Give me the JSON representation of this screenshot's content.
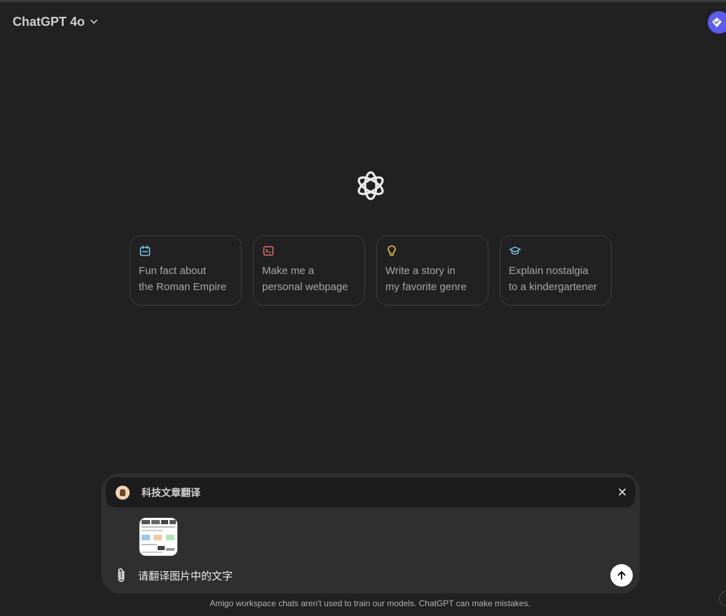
{
  "header": {
    "model_label": "ChatGPT 4o",
    "model_chevron_icon": "chevron-down-icon",
    "extension_icon": "diamond-check-icon",
    "extension_color": "#5b5cf0"
  },
  "hero": {
    "logo_icon": "openai-logo-icon"
  },
  "suggestions": [
    {
      "icon": "calendar-icon",
      "color": "#7cc4e8",
      "line1": "Fun fact about",
      "line2": "the Roman Empire"
    },
    {
      "icon": "terminal-icon",
      "color": "#e26d6d",
      "line1": "Make me a",
      "line2": "personal webpage"
    },
    {
      "icon": "lightbulb-icon",
      "color": "#e8c547",
      "line1": "Write a story in",
      "line2": "my favorite genre"
    },
    {
      "icon": "graduation-cap-icon",
      "color": "#7cc4e8",
      "line1": "Explain nostalgia",
      "line2": "to a kindergartener"
    }
  ],
  "composer": {
    "gpt_name": "科技文章翻译",
    "gpt_close_icon": "close-icon",
    "attachment_icon": "paperclip-icon",
    "input_value": "请翻译图片中的文字",
    "send_icon": "arrow-up-icon"
  },
  "footer": {
    "disclaimer": "Amigo workspace chats aren't used to train our models. ChatGPT can make mistakes."
  }
}
